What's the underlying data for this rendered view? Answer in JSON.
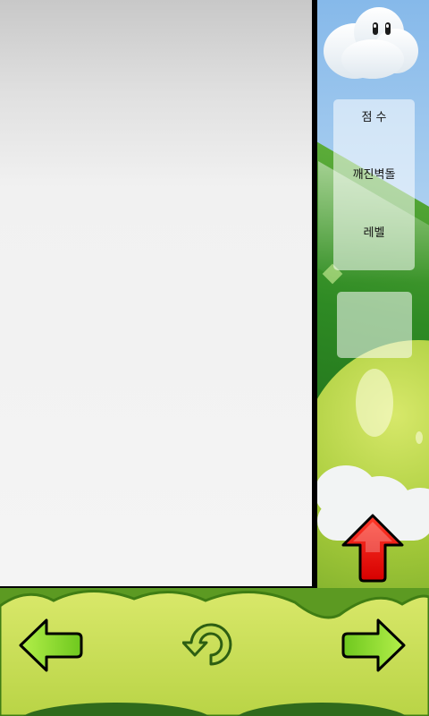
{
  "info_panel": {
    "score_label": "점 수",
    "bricks_label": "깨진벽돌",
    "level_label": "레벨"
  },
  "controls": {
    "left_icon": "left-arrow-icon",
    "rotate_icon": "rotate-icon",
    "right_icon": "right-arrow-icon",
    "up_icon": "up-arrow-icon"
  },
  "colors": {
    "arrow_green": "#86d92a",
    "arrow_red": "#ee1111",
    "ground_green": "#cfe05a"
  }
}
